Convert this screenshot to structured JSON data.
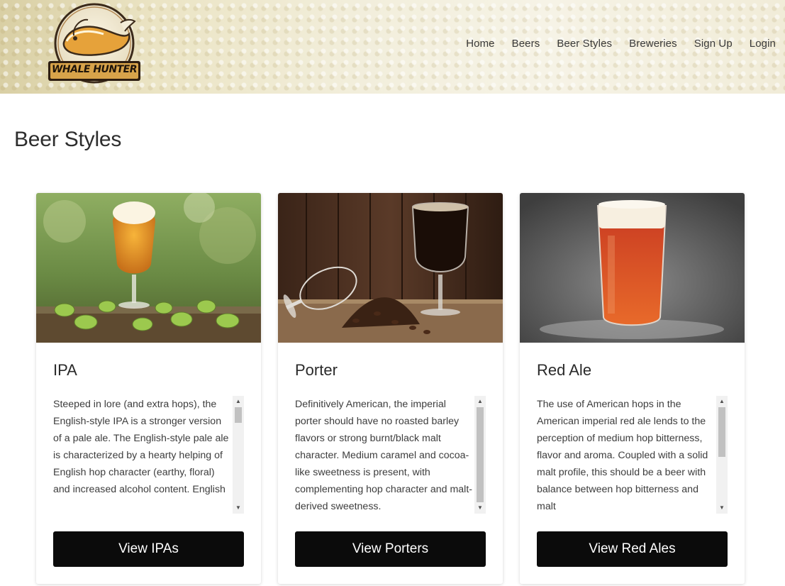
{
  "header": {
    "logo_text": "WHALE HUNTER",
    "nav": [
      "Home",
      "Beers",
      "Beer Styles",
      "Breweries",
      "Sign Up",
      "Login"
    ]
  },
  "page_title": "Beer Styles",
  "cards": [
    {
      "title": "IPA",
      "description": "Steeped in lore (and extra hops), the English-style IPA is a stronger version of a pale ale. The English-style pale ale is characterized by a hearty helping of English hop character (earthy, floral) and increased alcohol content. English",
      "button": "View IPAs",
      "image": "ipa-glass-with-hops-photo",
      "scroll_position": 0
    },
    {
      "title": "Porter",
      "description": "Definitively American, the imperial porter should have no roasted barley flavors or strong burnt/black malt character. Medium caramel and cocoa-like sweetness is present, with complementing hop character and malt-derived sweetness.",
      "button": "View Porters",
      "image": "porter-glass-with-coffee-beans-photo",
      "scroll_position": 0
    },
    {
      "title": "Red Ale",
      "description": "The use of American hops in the American imperial red ale lends to the perception of medium hop bitterness, flavor and aroma. Coupled with a solid malt profile, this should be a beer with balance between hop bitterness and malt",
      "button": "View Red Ales",
      "image": "red-ale-pint-glass-photo",
      "scroll_position": 0
    }
  ],
  "colors": {
    "button_bg": "#0b0b0b",
    "button_text": "#ffffff",
    "header_bg": "#efe9d2"
  }
}
